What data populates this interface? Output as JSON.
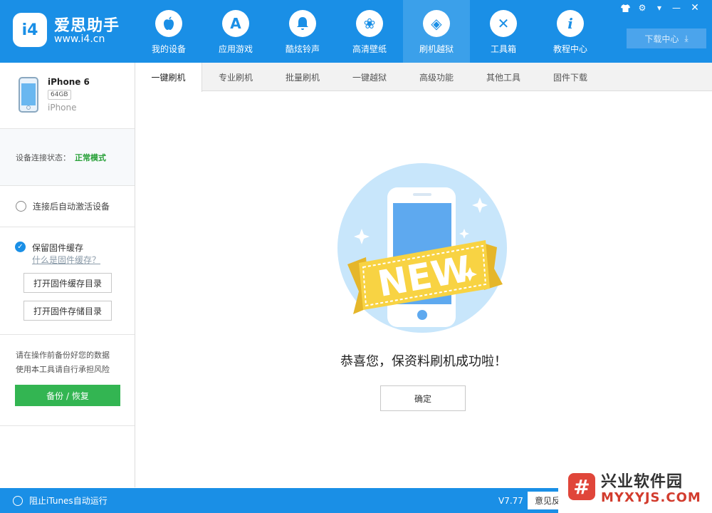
{
  "brand": {
    "logo_text": "i4",
    "name": "爱思助手",
    "url": "www.i4.cn"
  },
  "nav": [
    {
      "label": "我的设备",
      "icon": "apple-icon",
      "glyph": "",
      "active": false
    },
    {
      "label": "应用游戏",
      "icon": "app-store-icon",
      "glyph": "A",
      "active": false
    },
    {
      "label": "酷炫铃声",
      "icon": "bell-icon",
      "glyph": "♪",
      "active": false
    },
    {
      "label": "高清壁纸",
      "icon": "flower-icon",
      "glyph": "❀",
      "active": false
    },
    {
      "label": "刷机越狱",
      "icon": "dropbox-icon",
      "glyph": "◈",
      "active": true
    },
    {
      "label": "工具箱",
      "icon": "tools-icon",
      "glyph": "✕",
      "active": false
    },
    {
      "label": "教程中心",
      "icon": "info-icon",
      "glyph": "i",
      "active": false
    }
  ],
  "system_icons": [
    {
      "name": "tshirt-icon",
      "glyph": "👕"
    },
    {
      "name": "gear-icon",
      "glyph": "⚙"
    },
    {
      "name": "menu-icon",
      "glyph": "▾"
    },
    {
      "name": "minimize-icon",
      "glyph": "—"
    },
    {
      "name": "close-icon",
      "glyph": "✕"
    }
  ],
  "download_center": {
    "label": "下载中心",
    "icon": "download-icon",
    "glyph": "⤓"
  },
  "device": {
    "name": "iPhone 6",
    "capacity": "64GB",
    "type": "iPhone"
  },
  "connection": {
    "label": "设备连接状态：",
    "value": "正常模式",
    "value_color": "#2aa13a"
  },
  "auto_activate": {
    "label": "连接后自动激活设备",
    "checked": false
  },
  "firmware": {
    "keep_cache_label": "保留固件缓存",
    "keep_cache_checked": true,
    "what_is_cache_link": "什么是固件缓存？",
    "open_cache_dir": "打开固件缓存目录",
    "open_storage_dir": "打开固件存储目录"
  },
  "backup": {
    "warning_line1": "请在操作前备份好您的数据",
    "warning_line2": "使用本工具请自行承担风险",
    "button": "备份 / 恢复"
  },
  "tabs": [
    {
      "label": "一键刷机",
      "active": true
    },
    {
      "label": "专业刷机",
      "active": false
    },
    {
      "label": "批量刷机",
      "active": false
    },
    {
      "label": "一键越狱",
      "active": false
    },
    {
      "label": "高级功能",
      "active": false
    },
    {
      "label": "其他工具",
      "active": false
    },
    {
      "label": "固件下载",
      "active": false
    }
  ],
  "illustration": {
    "banner_text": "NEW"
  },
  "success_message": "恭喜您，保资料刷机成功啦！",
  "confirm_button": "确定",
  "bottom": {
    "itunes_label": "阻止iTunes自动运行",
    "version": "V7.77",
    "feedback_button": "意见反馈"
  },
  "watermark": {
    "title": "兴业软件园",
    "subtitle": "MYXYJS.COM",
    "logo_glyph": "#"
  },
  "colors": {
    "primary": "#1a8fe6",
    "success_green": "#33b552",
    "status_green": "#2aa13a",
    "banner_yellow": "#f8d343"
  }
}
